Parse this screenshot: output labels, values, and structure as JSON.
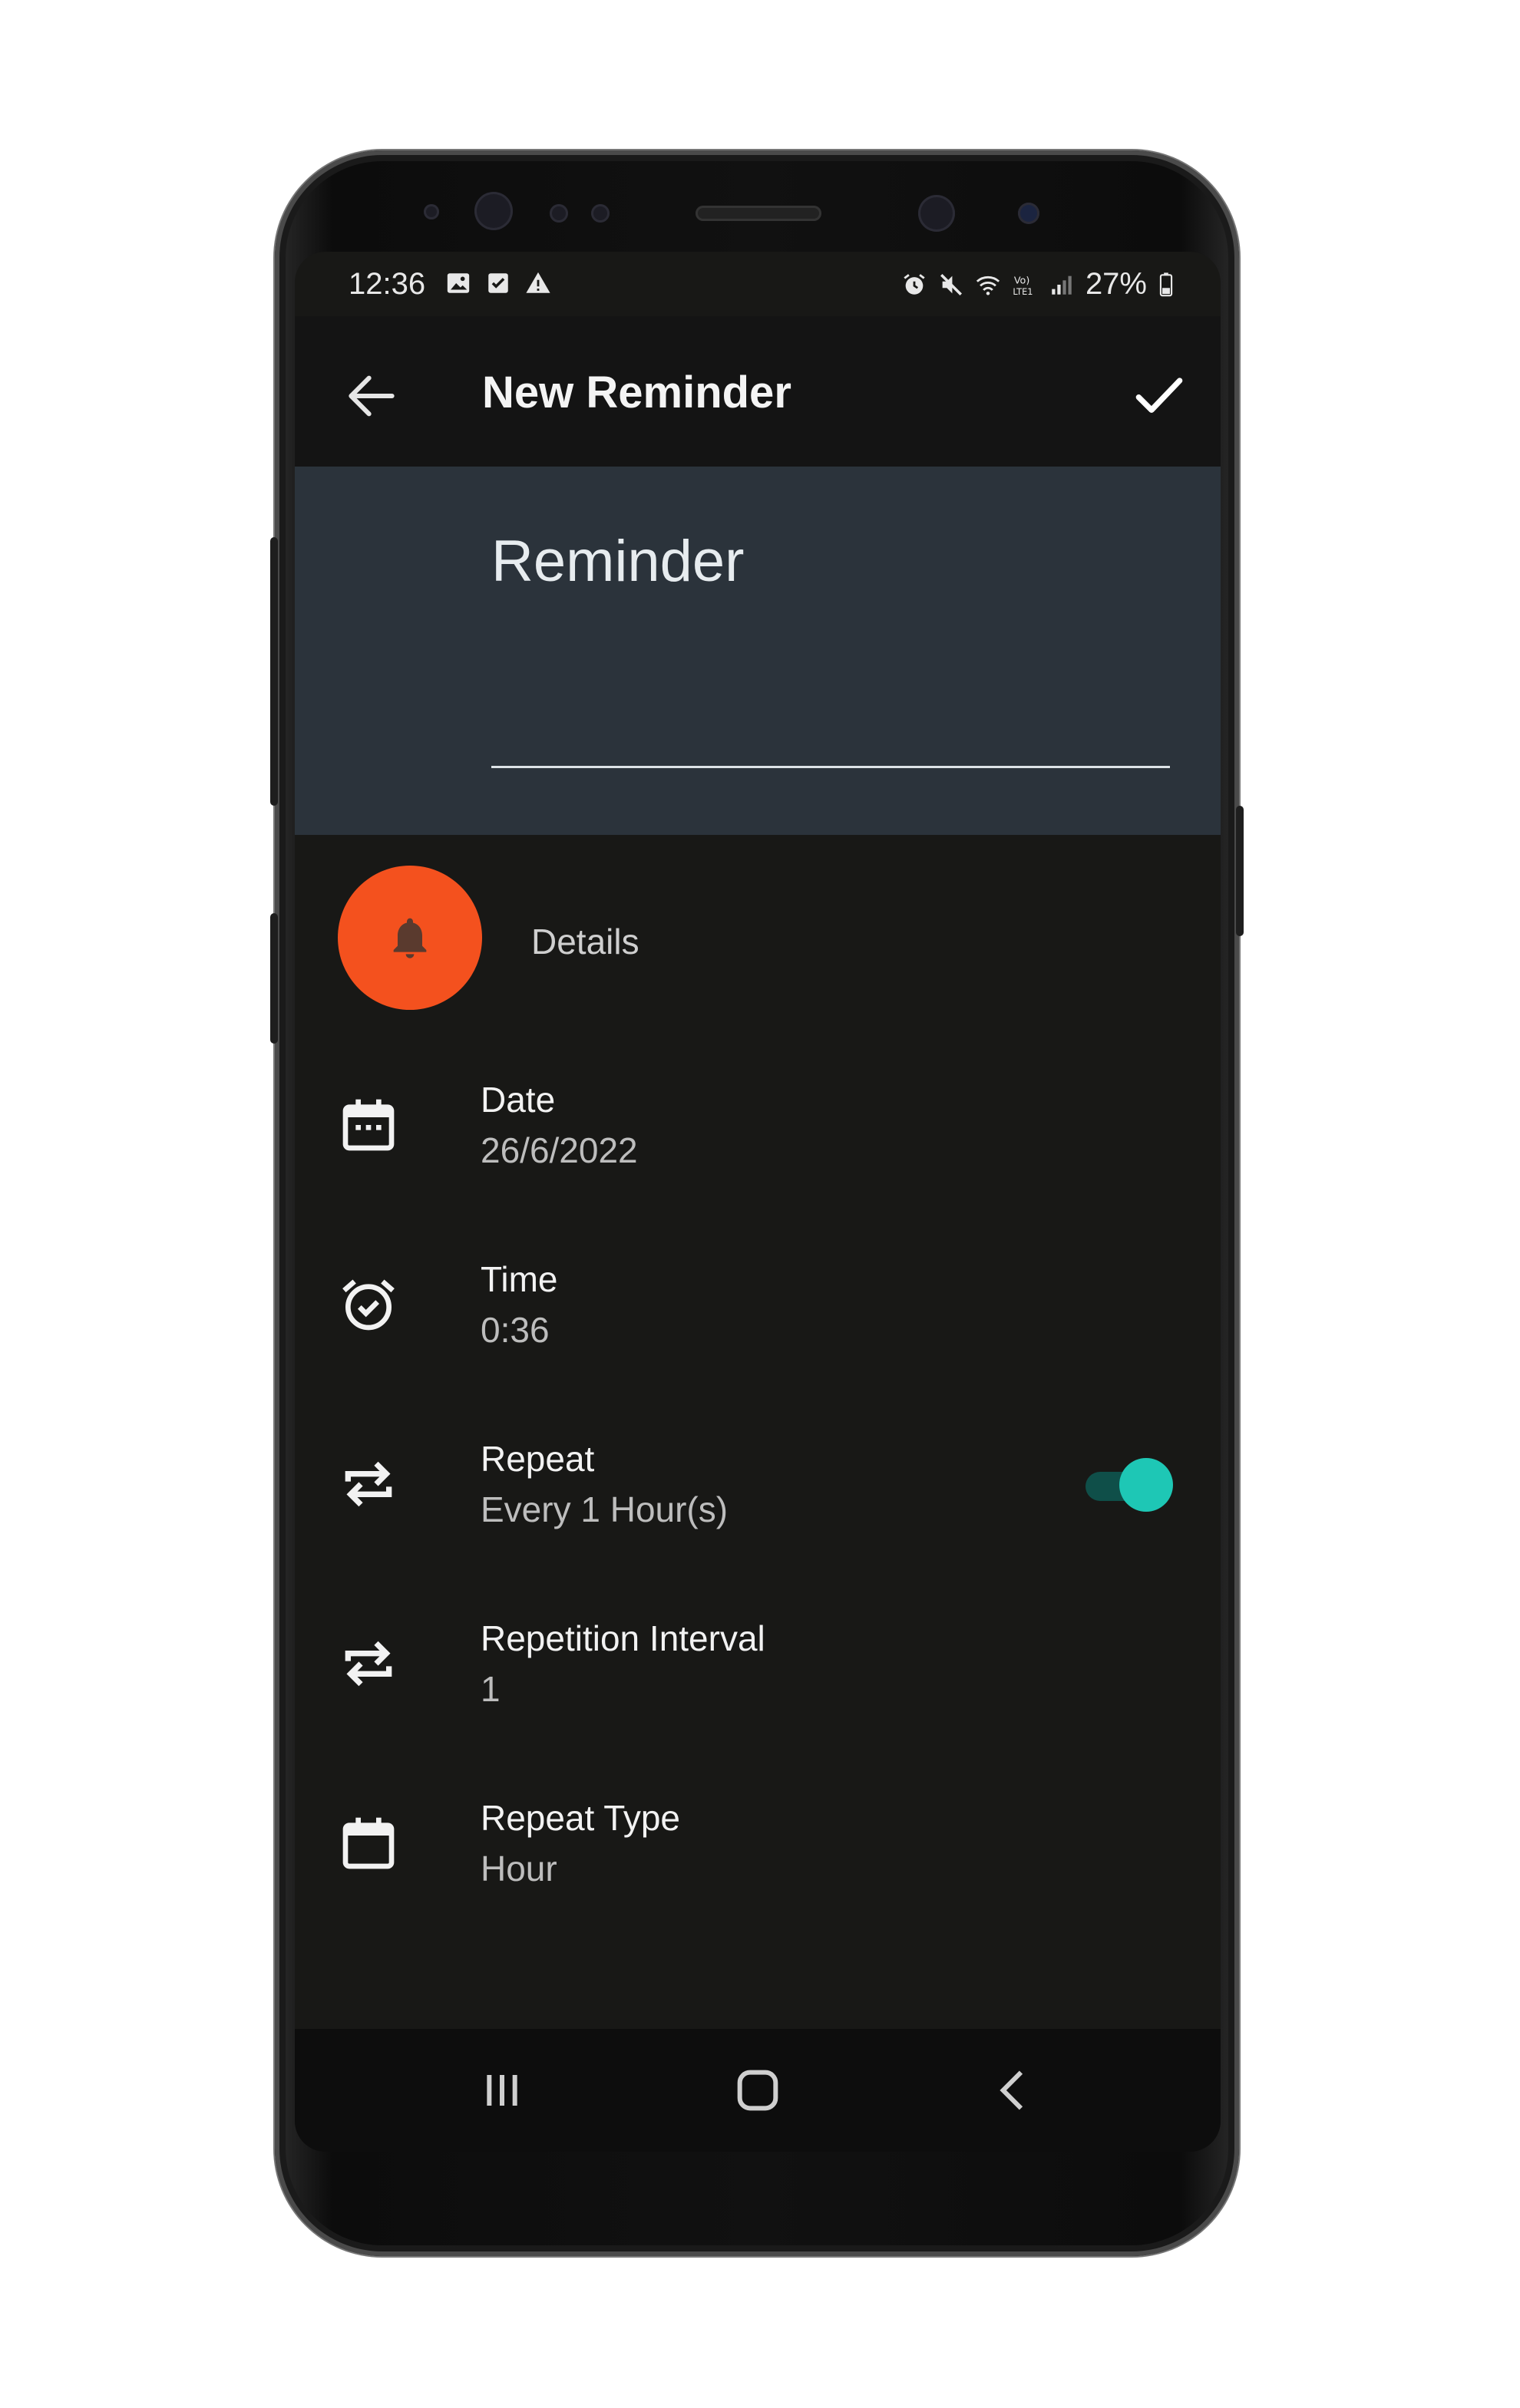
{
  "statusbar": {
    "time": "12:36",
    "battery": "27%",
    "left_icons": [
      "image-icon",
      "check-box-icon",
      "warning-icon"
    ],
    "right_icons": [
      "alarm-icon",
      "mute-icon",
      "wifi-icon",
      "volte-icon",
      "signal-icon",
      "battery-icon"
    ]
  },
  "appbar": {
    "title": "New Reminder",
    "back_icon": "arrow-back-icon",
    "confirm_icon": "check-icon"
  },
  "title_field": {
    "placeholder": "Reminder"
  },
  "details": {
    "label": "Details",
    "fab_icon": "bell-icon",
    "fab_color": "#f4511e"
  },
  "rows": [
    {
      "icon": "calendar-icon",
      "title": "Date",
      "value": "26/6/2022"
    },
    {
      "icon": "alarm-clock-icon",
      "title": "Time",
      "value": "0:36"
    },
    {
      "icon": "repeat-icon",
      "title": "Repeat",
      "value": "Every 1 Hour(s)",
      "toggle": true
    },
    {
      "icon": "repeat-icon",
      "title": "Repetition Interval",
      "value": "1"
    },
    {
      "icon": "calendar-blank-icon",
      "title": "Repeat Type",
      "value": "Hour"
    }
  ],
  "colors": {
    "accent_toggle": "#1ec7b5",
    "background": "#181816",
    "header": "#2b333b"
  },
  "navbar": {
    "buttons": [
      "recents-icon",
      "home-icon",
      "back-icon"
    ]
  }
}
